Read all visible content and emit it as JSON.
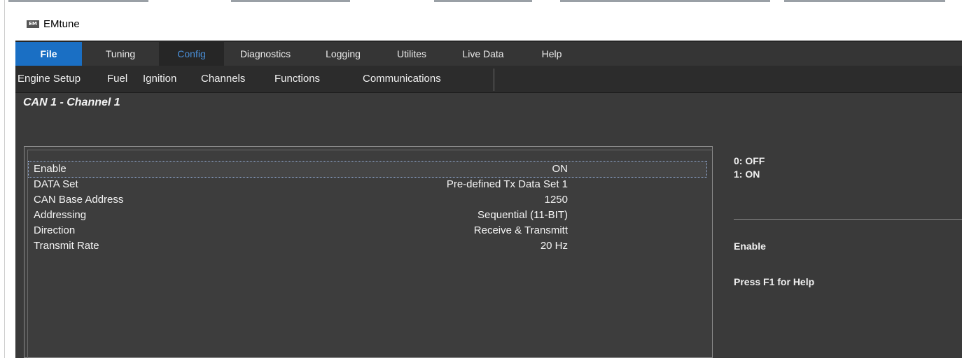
{
  "app": {
    "title": "EMtune",
    "logo_text": "EM"
  },
  "menu": [
    {
      "label": "File",
      "state": "file"
    },
    {
      "label": "Tuning",
      "state": "normal"
    },
    {
      "label": "Config",
      "state": "active"
    },
    {
      "label": "Diagnostics",
      "state": "normal"
    },
    {
      "label": "Logging",
      "state": "normal"
    },
    {
      "label": "Utilites",
      "state": "normal"
    },
    {
      "label": "Live Data",
      "state": "normal"
    },
    {
      "label": "Help",
      "state": "normal"
    }
  ],
  "submenu": [
    {
      "label": "Engine Setup"
    },
    {
      "label": "Fuel"
    },
    {
      "label": "Ignition"
    },
    {
      "label": "Channels"
    },
    {
      "label": "Functions"
    },
    {
      "label": "Communications"
    }
  ],
  "page": {
    "title": "CAN 1 - Channel 1"
  },
  "params": [
    {
      "name": "Enable",
      "value": "ON",
      "selected": true
    },
    {
      "name": "DATA Set",
      "value": "Pre-defined Tx Data Set 1"
    },
    {
      "name": "CAN Base Address",
      "value": "1250"
    },
    {
      "name": "Addressing",
      "value": "Sequential (11-BIT)"
    },
    {
      "name": "Direction",
      "value": "Receive & Transmitt"
    },
    {
      "name": "Transmit Rate",
      "value": "20 Hz"
    }
  ],
  "help": {
    "options": [
      "0: OFF",
      "1: ON"
    ],
    "param_name": "Enable",
    "hint": "Press F1 for Help"
  },
  "colors": {
    "file_menu": "#1a6fc4",
    "active_menu_text": "#4a8fd8",
    "background": "#3a3a3a"
  }
}
